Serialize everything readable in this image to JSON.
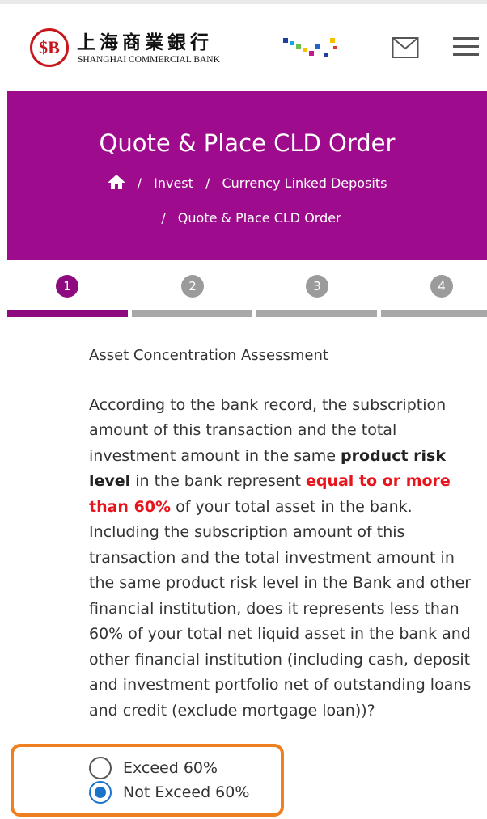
{
  "header": {
    "logo_mark": "$B",
    "bank_name_cn": "上海商業銀行",
    "bank_name_en": "SHANGHAI COMMERCIAL BANK",
    "icons": [
      "mail-icon",
      "menu-icon"
    ]
  },
  "hero": {
    "title": "Quote & Place CLD Order",
    "breadcrumb": {
      "home_icon": "home-icon",
      "items": [
        "Invest",
        "Currency Linked Deposits",
        "Quote & Place CLD Order"
      ]
    },
    "background": "#9e0b8c"
  },
  "steps": {
    "items": [
      "1",
      "2",
      "3",
      "4"
    ],
    "active": 1,
    "active_color": "#8d0b7e"
  },
  "assessment": {
    "heading": "Asset Concentration Assessment",
    "p1_part1": "According to the bank record, the subscription amount of this transaction and the total investment amount in the same ",
    "p1_bold": "product risk level",
    "p1_part2": " in the bank represent ",
    "p1_red": "equal to or more than 60%",
    "p1_part3": " of your total asset in the bank.",
    "p2": "Including the subscription amount of this transaction and the total investment amount in the same product risk level in the Bank and other financial institution, does it represents less than 60% of your total net liquid asset in the bank and other financial institution (including cash, deposit and investment portfolio net of outstanding loans and credit (exclude mortgage loan))?"
  },
  "options": {
    "items": [
      "Exceed 60%",
      "Not Exceed 60%"
    ],
    "selected": "Not Exceed 60%",
    "highlight_color": "#f07f1f"
  }
}
